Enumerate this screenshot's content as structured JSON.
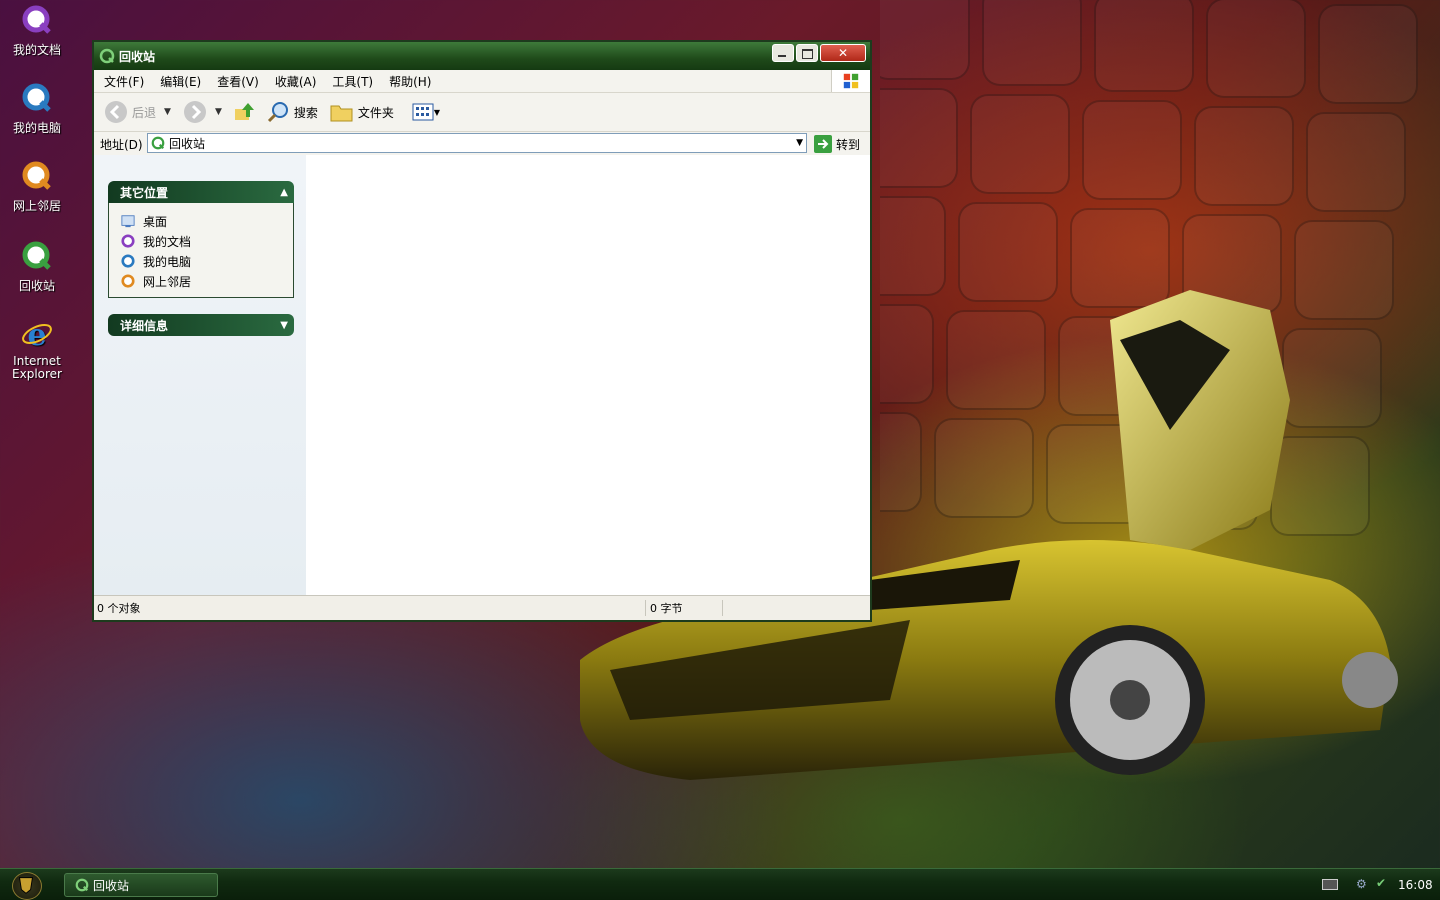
{
  "desktop": {
    "icons": [
      {
        "label": "我的文档",
        "icon": "my-documents-icon",
        "color": "#8a3fc0"
      },
      {
        "label": "我的电脑",
        "icon": "my-computer-icon",
        "color": "#2a7ac0"
      },
      {
        "label": "网上邻居",
        "icon": "network-places-icon",
        "color": "#e08a20"
      },
      {
        "label": "回收站",
        "icon": "recycle-bin-icon",
        "color": "#3aa040"
      },
      {
        "label": "Internet Explorer",
        "icon": "internet-explorer-icon",
        "color": "#2a80d0"
      }
    ]
  },
  "window": {
    "title": "回收站",
    "menu": [
      "文件(F)",
      "编辑(E)",
      "查看(V)",
      "收藏(A)",
      "工具(T)",
      "帮助(H)"
    ],
    "toolbar": {
      "back": "后退",
      "search": "搜索",
      "folders": "文件夹"
    },
    "address": {
      "label": "地址(D)",
      "value": "回收站",
      "go": "转到"
    },
    "tasks": {
      "other_places": {
        "title": "其它位置",
        "items": [
          {
            "label": "桌面",
            "icon": "desktop-icon",
            "color": "#4a7ac0"
          },
          {
            "label": "我的文档",
            "icon": "my-documents-icon",
            "color": "#8a3fc0"
          },
          {
            "label": "我的电脑",
            "icon": "my-computer-icon",
            "color": "#2a7ac0"
          },
          {
            "label": "网上邻居",
            "icon": "network-places-icon",
            "color": "#e08a20"
          }
        ]
      },
      "details": {
        "title": "详细信息"
      }
    },
    "status": {
      "objects": "0 个对象",
      "size": "0 字节"
    }
  },
  "taskbar": {
    "task_label": "回收站",
    "clock": "16:08"
  },
  "colors": {
    "titlebar": "#1f4a1a",
    "task_header": "#123a20",
    "taskbar": "#102a10"
  }
}
